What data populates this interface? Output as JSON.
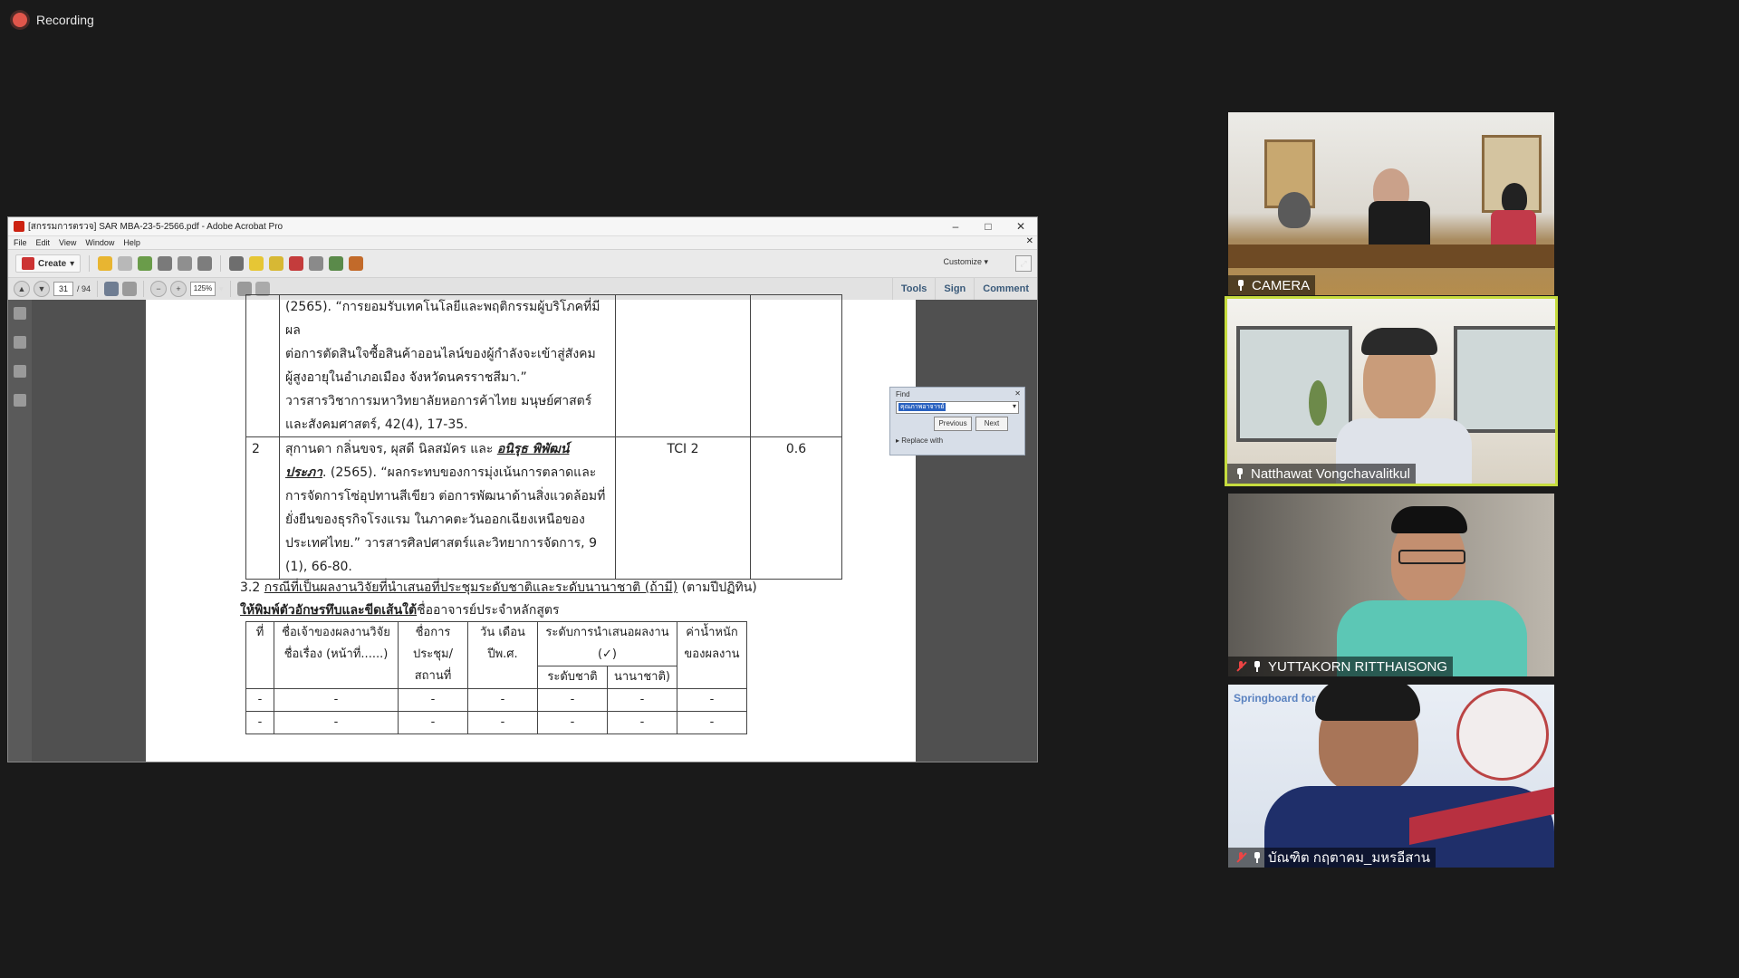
{
  "recording": {
    "label": "Recording"
  },
  "acrobat": {
    "title": "[สกรรมการตรวจ] SAR MBA-23-5-2566.pdf - Adobe Acrobat Pro",
    "menu": [
      "File",
      "Edit",
      "View",
      "Window",
      "Help"
    ],
    "create_label": "Create",
    "customize_label": "Customize",
    "page_current": "31",
    "page_total": "/ 94",
    "zoom": "125%",
    "tabs": [
      "Tools",
      "Sign",
      "Comment"
    ],
    "find": {
      "label": "Find",
      "query": "คุณภาพอาจารย์",
      "prev": "Previous",
      "next": "Next",
      "replace": "Replace with"
    }
  },
  "doc": {
    "row1": {
      "lines": [
        "(2565). “การยอมรับเทคโนโลยีและพฤติกรรมผู้บริโภคที่มีผล",
        "ต่อการตัดสินใจซื้อสินค้าออนไลน์ของผู้กำลังจะเข้าสู่สังคม",
        "ผู้สูงอายุในอำเภอเมือง จังหวัดนครราชสีมา.”",
        "วารสารวิชาการมหาวิทยาลัยหอการค้าไทย มนุษย์ศาสตร์",
        "และสังคมศาสตร์, 42(4), 17-35."
      ]
    },
    "row2": {
      "num": "2",
      "authors": "สุกานดา กลิ่นขจร, ผุสดี นิลสมัคร และ",
      "highlight": "อนิรุธ พิพัฒน์",
      "highlight2": "ประภา",
      "lines": [
        ". (2565).  “ผลกระทบของการมุ่งเน้นการตลาดและ",
        "การจัดการโซ่อุปทานสีเขียว ต่อการพัฒนาด้านสิ่งแวดล้อมที่",
        "ยั่งยืนของธุรกิจโรงแรม ในภาคตะวันออกเฉียงเหนือของ",
        "ประเทศไทย.” วารสารศิลปศาสตร์และวิทยาการจัดการ, 9",
        "(1), 66-80."
      ],
      "tci": "TCI 2",
      "value": "0.6"
    },
    "section_prefix": "3.2 ",
    "section_title": "กรณีที่เป็นผลงานวิจัยที่นำเสนอที่ประชุมระดับชาติและระดับนานาชาติ  (ถ้ามี)",
    "section_suffix": " (ตามปีปฏิทิน)",
    "instruction_bold": "ให้พิมพ์ตัวอักษรทึบและขีดเส้นใต้",
    "instruction_rest": "ชื่ออาจารย์ประจำหลักสูตร",
    "table2": {
      "headers": [
        "ที่",
        "ชื่อเจ้าของผลงานวิจัย ชื่อเรื่อง (หน้าที่......)",
        "ชื่อการ ประชุม/ สถานที่",
        "วัน เดือน ปีพ.ศ.",
        "ระดับการนำเสนอผลงาน (✓)",
        "ค่าน้ำหนัก ของผลงาน"
      ],
      "subheaders": [
        "ระดับชาติ",
        "นานาชาติ)"
      ],
      "rows": [
        [
          "-",
          "-",
          "-",
          "-",
          "-",
          "-",
          "-"
        ],
        [
          "-",
          "-",
          "-",
          "-",
          "-",
          "-",
          "-"
        ]
      ]
    }
  },
  "participants": [
    {
      "name": "CAMERA",
      "muted": false
    },
    {
      "name": "Natthawat Vongchavalitkul",
      "muted": false,
      "active": true
    },
    {
      "name": "YUTTAKORN RITTHAISONG",
      "muted": true
    },
    {
      "name": "บัณฑิต กฤตาคม_มหรอีสาน",
      "muted": true
    }
  ],
  "tile4_banner": "Springboard for th",
  "colors": {
    "active_speaker": "#c6dc3e",
    "recording": "#e0564b"
  }
}
